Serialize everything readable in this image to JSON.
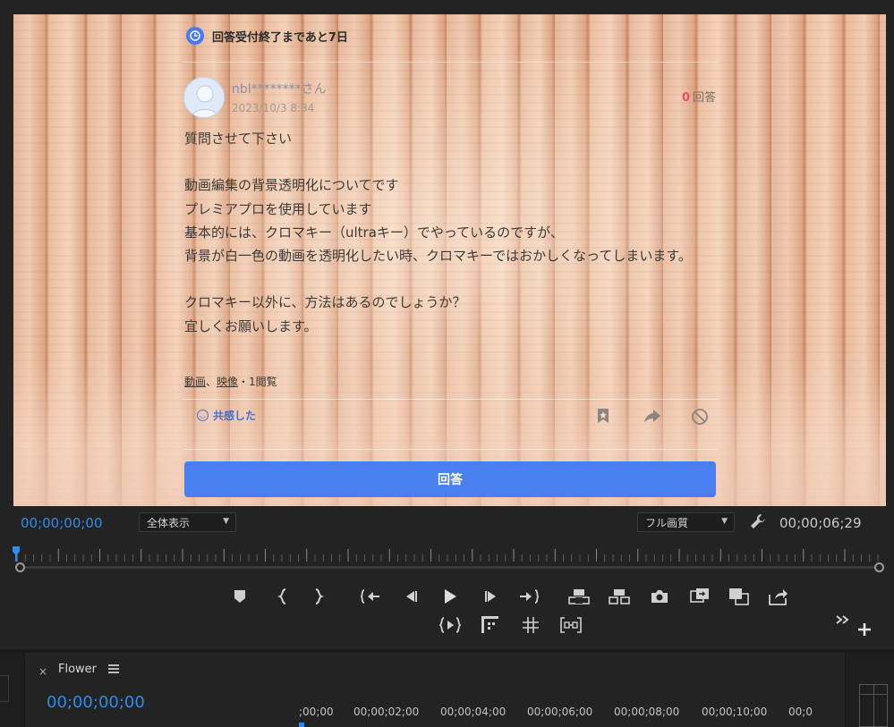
{
  "preview": {
    "deadline": "回答受付終了まであと7日",
    "username": "nbl********さん",
    "posted_at": "2023/10/3 8:34",
    "answers_count": "0",
    "answers_label": "回答",
    "body_lines": [
      "質問させて下さい",
      "",
      "動画編集の背景透明化についてです",
      "プレミアプロを使用しています",
      "基本的には、クロマキー（ultraキー）でやっているのですが、",
      "背景が白一色の動画を透明化したい時、クロマキーではおかしくなってしまいます。",
      "",
      "クロマキー以外に、方法はあるのでしょうか？",
      "宜しくお願いします。"
    ],
    "tags": {
      "tag1": "動画",
      "tag2": "映像",
      "views": "・1閲覧"
    },
    "empathy_label": "共感した",
    "answer_button": "回答"
  },
  "monitor": {
    "timecode_current": "00;00;00;00",
    "zoom_select": "全体表示",
    "quality_select": "フル画質",
    "timecode_duration": "00;00;06;29"
  },
  "timeline": {
    "close_symbol": "×",
    "sequence_name": "Flower",
    "timecode": "00;00;00;00",
    "ruler_labels": [
      ";00;00",
      "00;00;02;00",
      "00;00;04;00",
      "00;00;06;00",
      "00;00;08;00",
      "00;00;10;00",
      "00;0"
    ]
  },
  "colors": {
    "accent_blue": "#2d8ceb",
    "answer_button_blue": "#4b7ff0",
    "panel_bg": "#232323"
  },
  "icons": [
    "clock-icon",
    "bookmark-icon",
    "share-icon",
    "block-icon",
    "wrench-icon",
    "add-marker-icon",
    "mark-in-icon",
    "mark-out-icon",
    "go-to-in-icon",
    "step-back-icon",
    "play-icon",
    "step-forward-icon",
    "go-to-out-icon",
    "lift-icon",
    "extract-icon",
    "export-frame-icon",
    "insert-icon",
    "overwrite-icon",
    "export-icon",
    "play-in-to-out-icon",
    "safe-margins-icon",
    "grid-icon",
    "compare-icon",
    "more-icon",
    "add-button-icon"
  ]
}
